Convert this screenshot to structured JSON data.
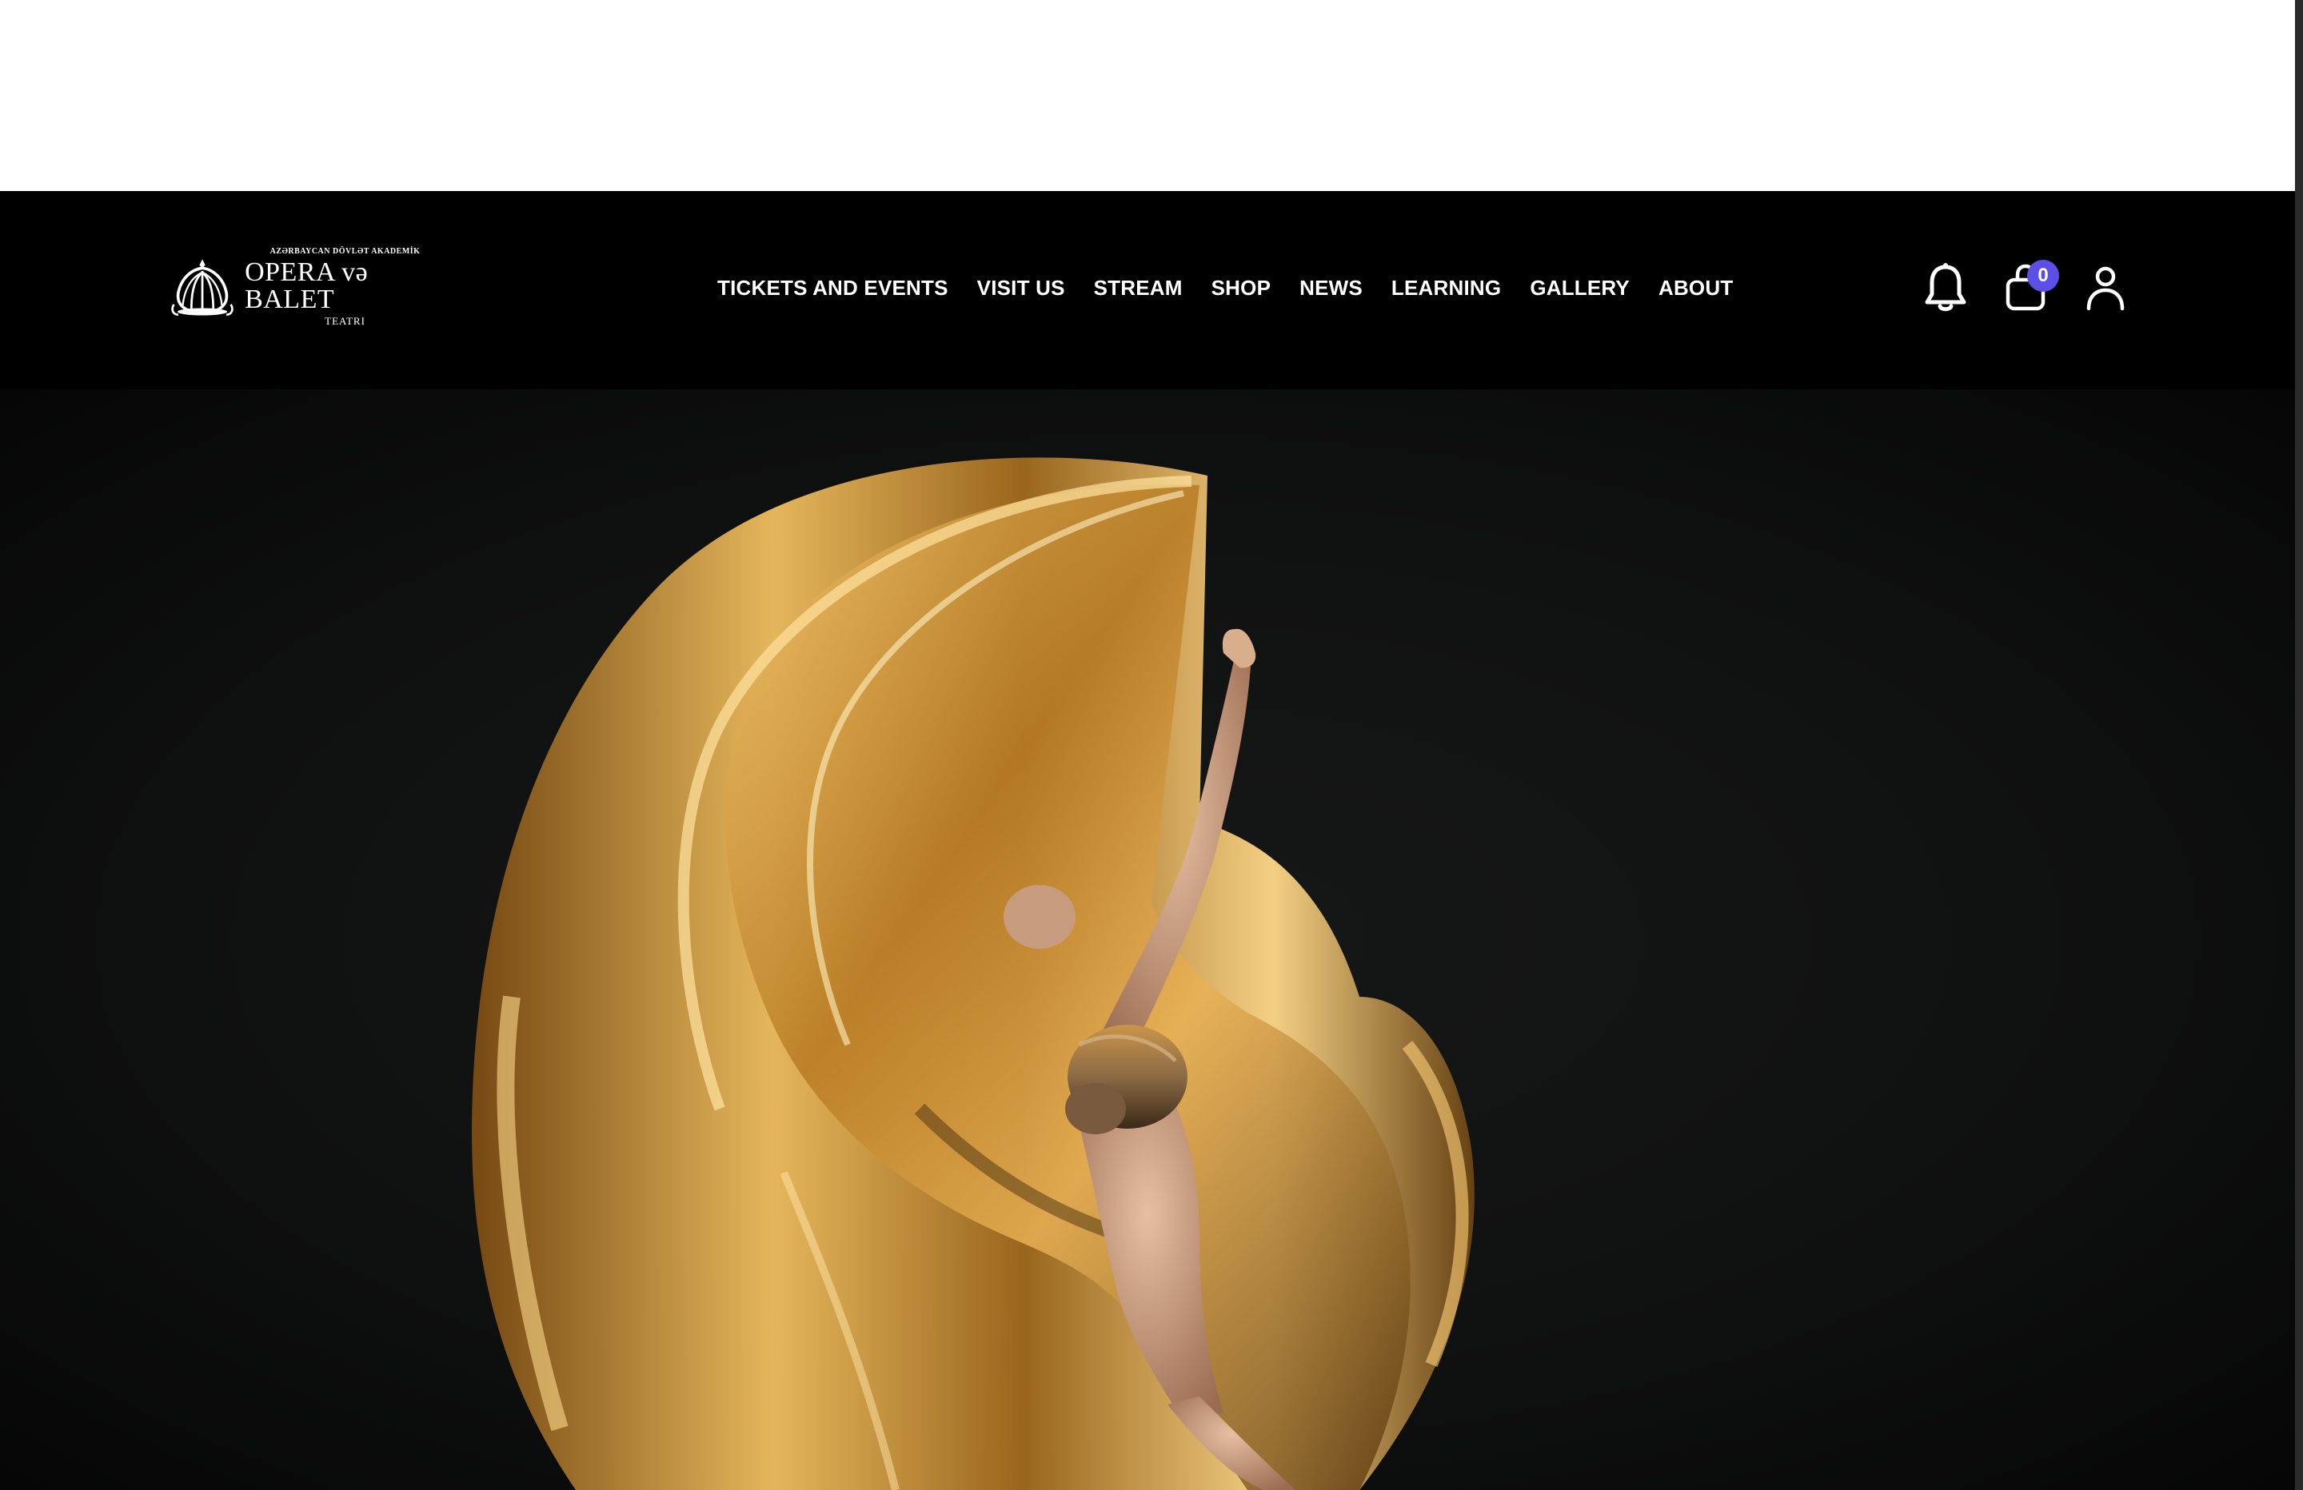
{
  "header": {
    "logo": {
      "small_text": "AZƏRBAYCAN DÖVLƏT AKADEMİK",
      "main_text": "OPERA və BALET",
      "sub_text": "TEATRI"
    },
    "nav": [
      {
        "label": "TICKETS AND EVENTS"
      },
      {
        "label": "VISIT US"
      },
      {
        "label": "STREAM"
      },
      {
        "label": "SHOP"
      },
      {
        "label": "NEWS"
      },
      {
        "label": "LEARNING"
      },
      {
        "label": "GALLERY"
      },
      {
        "label": "ABOUT"
      }
    ],
    "icons": {
      "notifications": "bell-icon",
      "cart": "shopping-bag-icon",
      "cart_count": "0",
      "account": "user-icon"
    }
  },
  "hero": {
    "image": "ballerina-in-gold-fabric",
    "accent_color": "#c8902f"
  },
  "colors": {
    "header_bg": "#000000",
    "badge": "#5b4fe8",
    "text": "#ffffff"
  }
}
